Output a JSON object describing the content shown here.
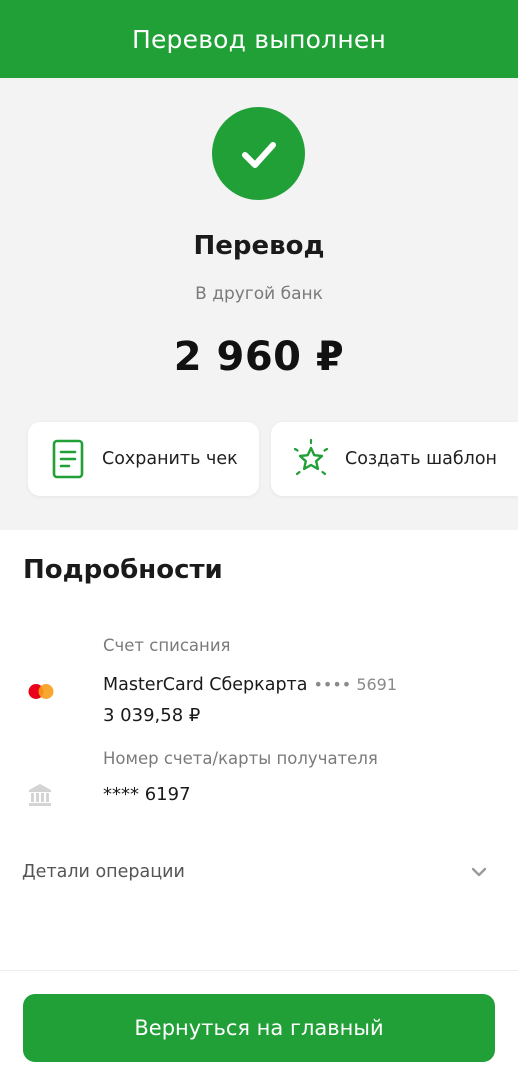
{
  "header": {
    "title": "Перевод выполнен"
  },
  "summary": {
    "status_icon": "check-icon",
    "title": "Перевод",
    "subtitle": "В другой банк",
    "amount": "2 960 ₽"
  },
  "actions": {
    "save_receipt": {
      "label": "Сохранить чек",
      "icon": "receipt-icon"
    },
    "create_template": {
      "label": "Создать шаблон",
      "icon": "star-sparkle-icon"
    }
  },
  "details": {
    "title": "Подробности",
    "debit_account": {
      "label": "Счет списания",
      "card_name": "MasterCard Сберкарта",
      "card_mask": "•••• 5691",
      "balance": "3 039,58 ₽",
      "icon": "mastercard-logo"
    },
    "recipient": {
      "label": "Номер счета/карты получателя",
      "value": "**** 6197",
      "icon": "bank-icon"
    },
    "operation_details": {
      "label": "Детали операции",
      "icon": "chevron-down-icon"
    }
  },
  "footer": {
    "home_button": "Вернуться на главный"
  },
  "colors": {
    "brand_green": "#21a038",
    "background_gray": "#f3f3f3",
    "mastercard_red": "#eb001b",
    "mastercard_orange": "#f79e1b"
  }
}
